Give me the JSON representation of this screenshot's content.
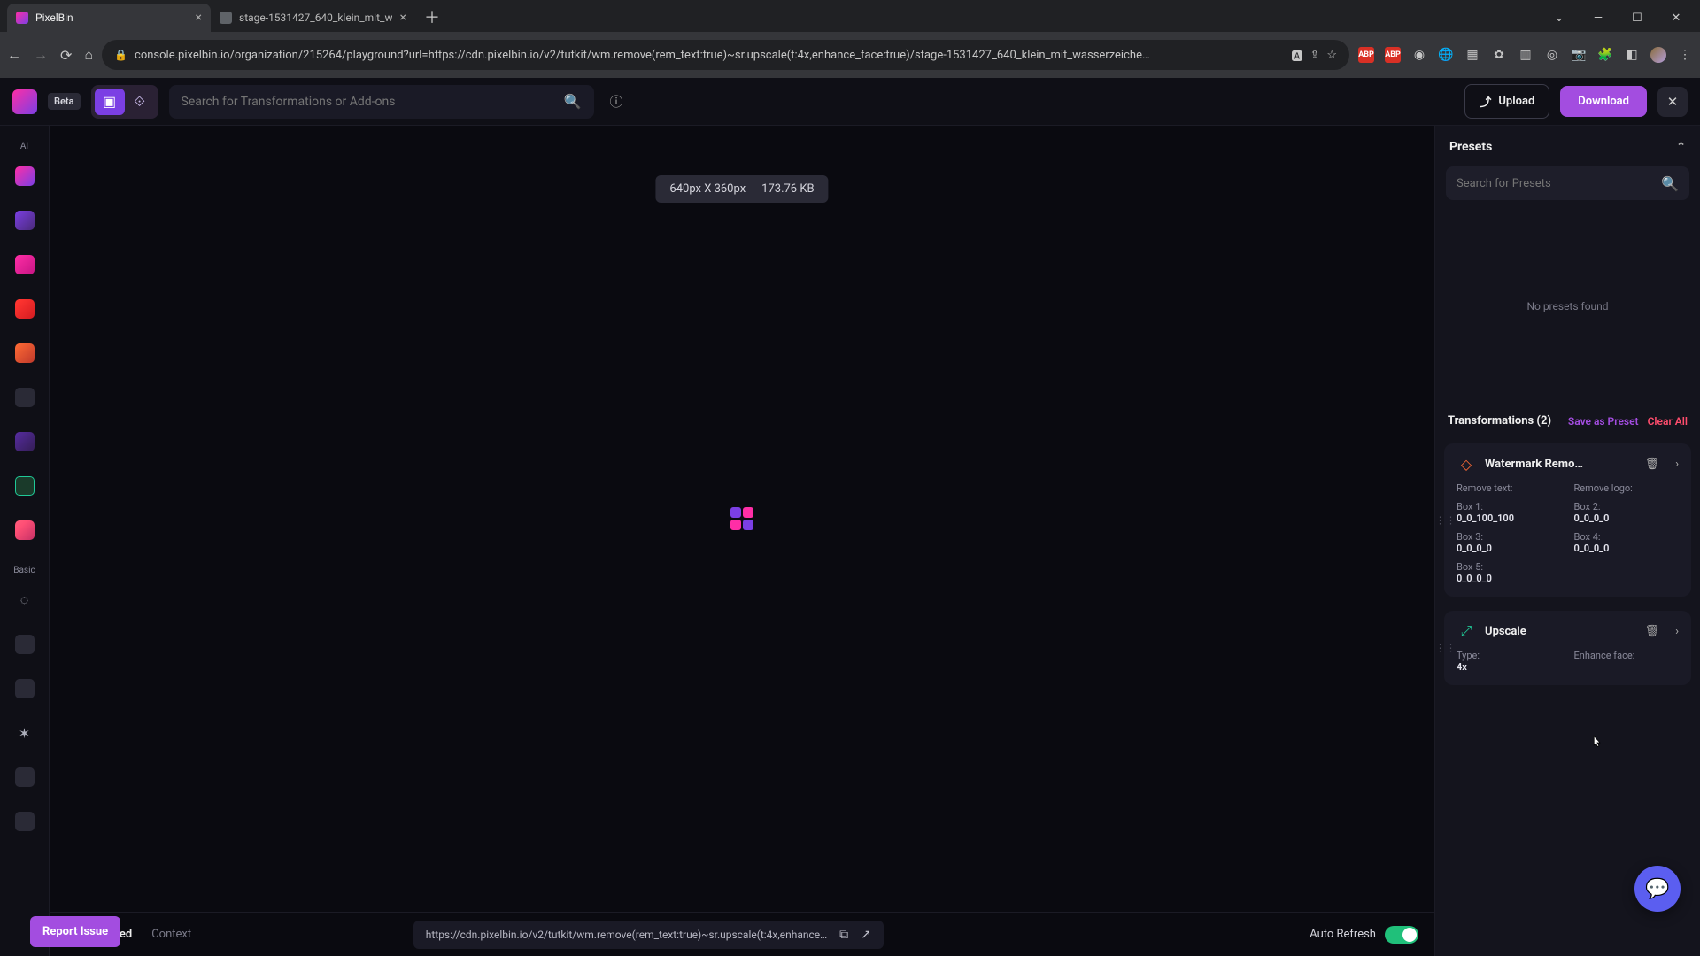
{
  "browser": {
    "tabs": [
      {
        "title": "PixelBin",
        "active": true
      },
      {
        "title": "stage-1531427_640_klein_mit_w",
        "active": false
      }
    ],
    "url": "console.pixelbin.io/organization/215264/playground?url=https://cdn.pixelbin.io/v2/tutkit/wm.remove(rem_text:true)~sr.upscale(t:4x,enhance_face:true)/stage-1531427_640_klein_mit_wasserzeiche…",
    "ext_badges": [
      "ABP",
      "ABP"
    ]
  },
  "header": {
    "beta_label": "Beta",
    "search_placeholder": "Search for Transformations or Add-ons",
    "upload_label": "Upload",
    "download_label": "Download"
  },
  "left_rail": {
    "section_ai": "AI",
    "section_basic": "Basic"
  },
  "canvas": {
    "dimensions": "640px X 360px",
    "filesize": "173.76 KB",
    "footer_tabs": {
      "transformed": "Transformed",
      "context": "Context"
    },
    "url_preview": "https://cdn.pixelbin.io/v2/tutkit/wm.remove(rem_text:true)~sr.upscale(t:4x,enhance…",
    "auto_refresh_label": "Auto Refresh"
  },
  "presets": {
    "title": "Presets",
    "search_placeholder": "Search for Presets",
    "empty_text": "No presets found"
  },
  "transformations": {
    "title": "Transformations (2)",
    "save_label": "Save as Preset",
    "clear_label": "Clear All",
    "items": [
      {
        "name": "Watermark Remo…",
        "params": {
          "remove_text_label": "Remove text:",
          "remove_logo_label": "Remove logo:",
          "box1_label": "Box 1:",
          "box1_val": "0_0_100_100",
          "box2_label": "Box 2:",
          "box2_val": "0_0_0_0",
          "box3_label": "Box 3:",
          "box3_val": "0_0_0_0",
          "box4_label": "Box 4:",
          "box4_val": "0_0_0_0",
          "box5_label": "Box 5:",
          "box5_val": "0_0_0_0"
        }
      },
      {
        "name": "Upscale",
        "params": {
          "type_label": "Type:",
          "type_val": "4x",
          "enhance_face_label": "Enhance face:"
        }
      }
    ]
  },
  "floating": {
    "report_issue": "Report Issue"
  }
}
